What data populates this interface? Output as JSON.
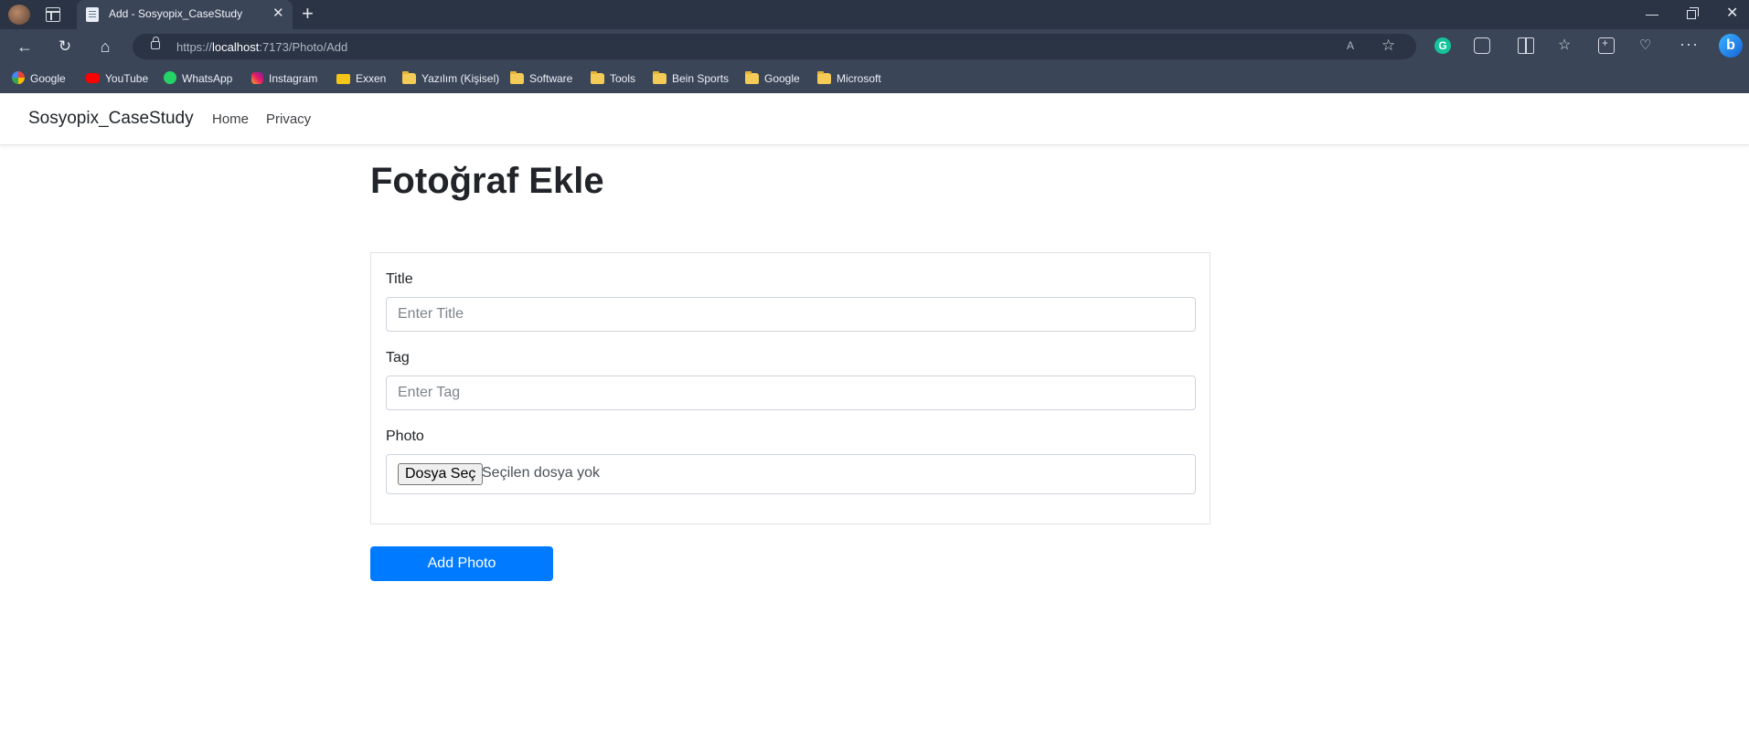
{
  "browser": {
    "tab_title": "Add - Sosyopix_CaseStudy",
    "tab_close": "✕",
    "new_tab": "+",
    "url_scheme": "https://",
    "url_host": "localhost",
    "url_path": ":7173/Photo/Add",
    "icons": {
      "back": "←",
      "reload": "↻",
      "home": "⌂",
      "minimize": "—",
      "close": "✕",
      "read_aloud": "A",
      "favorite": "☆",
      "grammarly": "G",
      "favorites_bar": "☆",
      "health": "♡",
      "more": "···",
      "bing": "b"
    },
    "bookmarks": [
      {
        "label": "Google",
        "icon": "google-icon"
      },
      {
        "label": "YouTube",
        "icon": "youtube-icon"
      },
      {
        "label": "WhatsApp",
        "icon": "whatsapp-icon"
      },
      {
        "label": "Instagram",
        "icon": "instagram-icon"
      },
      {
        "label": "Exxen",
        "icon": "exxen-icon"
      },
      {
        "label": "Yazılım (Kişisel)",
        "icon": "folder-icon"
      },
      {
        "label": "Software",
        "icon": "folder-icon"
      },
      {
        "label": "Tools",
        "icon": "folder-icon"
      },
      {
        "label": "Bein Sports",
        "icon": "folder-icon"
      },
      {
        "label": "Google",
        "icon": "folder-icon"
      },
      {
        "label": "Microsoft",
        "icon": "folder-icon"
      }
    ]
  },
  "site": {
    "brand": "Sosyopix_CaseStudy",
    "nav": [
      {
        "label": "Home"
      },
      {
        "label": "Privacy"
      }
    ]
  },
  "page": {
    "heading": "Fotoğraf Ekle",
    "form": {
      "title_label": "Title",
      "title_placeholder": "Enter Title",
      "title_value": "",
      "tag_label": "Tag",
      "tag_placeholder": "Enter Tag",
      "tag_value": "",
      "photo_label": "Photo",
      "file_button": "Dosya Seç",
      "file_status": "Seçilen dosya yok"
    },
    "submit_label": "Add Photo"
  },
  "colors": {
    "primary": "#007bff",
    "chrome_dark": "#2b3444",
    "chrome": "#3a4558"
  }
}
